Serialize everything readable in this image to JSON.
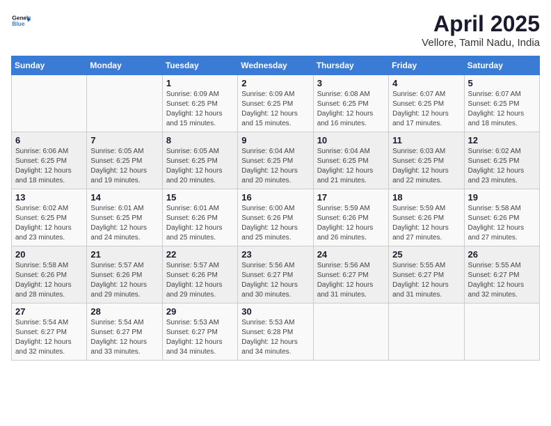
{
  "header": {
    "logo_line1": "General",
    "logo_line2": "Blue",
    "month": "April 2025",
    "location": "Vellore, Tamil Nadu, India"
  },
  "weekdays": [
    "Sunday",
    "Monday",
    "Tuesday",
    "Wednesday",
    "Thursday",
    "Friday",
    "Saturday"
  ],
  "weeks": [
    [
      {
        "day": "",
        "info": ""
      },
      {
        "day": "",
        "info": ""
      },
      {
        "day": "1",
        "info": "Sunrise: 6:09 AM\nSunset: 6:25 PM\nDaylight: 12 hours\nand 15 minutes."
      },
      {
        "day": "2",
        "info": "Sunrise: 6:09 AM\nSunset: 6:25 PM\nDaylight: 12 hours\nand 15 minutes."
      },
      {
        "day": "3",
        "info": "Sunrise: 6:08 AM\nSunset: 6:25 PM\nDaylight: 12 hours\nand 16 minutes."
      },
      {
        "day": "4",
        "info": "Sunrise: 6:07 AM\nSunset: 6:25 PM\nDaylight: 12 hours\nand 17 minutes."
      },
      {
        "day": "5",
        "info": "Sunrise: 6:07 AM\nSunset: 6:25 PM\nDaylight: 12 hours\nand 18 minutes."
      }
    ],
    [
      {
        "day": "6",
        "info": "Sunrise: 6:06 AM\nSunset: 6:25 PM\nDaylight: 12 hours\nand 18 minutes."
      },
      {
        "day": "7",
        "info": "Sunrise: 6:05 AM\nSunset: 6:25 PM\nDaylight: 12 hours\nand 19 minutes."
      },
      {
        "day": "8",
        "info": "Sunrise: 6:05 AM\nSunset: 6:25 PM\nDaylight: 12 hours\nand 20 minutes."
      },
      {
        "day": "9",
        "info": "Sunrise: 6:04 AM\nSunset: 6:25 PM\nDaylight: 12 hours\nand 20 minutes."
      },
      {
        "day": "10",
        "info": "Sunrise: 6:04 AM\nSunset: 6:25 PM\nDaylight: 12 hours\nand 21 minutes."
      },
      {
        "day": "11",
        "info": "Sunrise: 6:03 AM\nSunset: 6:25 PM\nDaylight: 12 hours\nand 22 minutes."
      },
      {
        "day": "12",
        "info": "Sunrise: 6:02 AM\nSunset: 6:25 PM\nDaylight: 12 hours\nand 23 minutes."
      }
    ],
    [
      {
        "day": "13",
        "info": "Sunrise: 6:02 AM\nSunset: 6:25 PM\nDaylight: 12 hours\nand 23 minutes."
      },
      {
        "day": "14",
        "info": "Sunrise: 6:01 AM\nSunset: 6:25 PM\nDaylight: 12 hours\nand 24 minutes."
      },
      {
        "day": "15",
        "info": "Sunrise: 6:01 AM\nSunset: 6:26 PM\nDaylight: 12 hours\nand 25 minutes."
      },
      {
        "day": "16",
        "info": "Sunrise: 6:00 AM\nSunset: 6:26 PM\nDaylight: 12 hours\nand 25 minutes."
      },
      {
        "day": "17",
        "info": "Sunrise: 5:59 AM\nSunset: 6:26 PM\nDaylight: 12 hours\nand 26 minutes."
      },
      {
        "day": "18",
        "info": "Sunrise: 5:59 AM\nSunset: 6:26 PM\nDaylight: 12 hours\nand 27 minutes."
      },
      {
        "day": "19",
        "info": "Sunrise: 5:58 AM\nSunset: 6:26 PM\nDaylight: 12 hours\nand 27 minutes."
      }
    ],
    [
      {
        "day": "20",
        "info": "Sunrise: 5:58 AM\nSunset: 6:26 PM\nDaylight: 12 hours\nand 28 minutes."
      },
      {
        "day": "21",
        "info": "Sunrise: 5:57 AM\nSunset: 6:26 PM\nDaylight: 12 hours\nand 29 minutes."
      },
      {
        "day": "22",
        "info": "Sunrise: 5:57 AM\nSunset: 6:26 PM\nDaylight: 12 hours\nand 29 minutes."
      },
      {
        "day": "23",
        "info": "Sunrise: 5:56 AM\nSunset: 6:27 PM\nDaylight: 12 hours\nand 30 minutes."
      },
      {
        "day": "24",
        "info": "Sunrise: 5:56 AM\nSunset: 6:27 PM\nDaylight: 12 hours\nand 31 minutes."
      },
      {
        "day": "25",
        "info": "Sunrise: 5:55 AM\nSunset: 6:27 PM\nDaylight: 12 hours\nand 31 minutes."
      },
      {
        "day": "26",
        "info": "Sunrise: 5:55 AM\nSunset: 6:27 PM\nDaylight: 12 hours\nand 32 minutes."
      }
    ],
    [
      {
        "day": "27",
        "info": "Sunrise: 5:54 AM\nSunset: 6:27 PM\nDaylight: 12 hours\nand 32 minutes."
      },
      {
        "day": "28",
        "info": "Sunrise: 5:54 AM\nSunset: 6:27 PM\nDaylight: 12 hours\nand 33 minutes."
      },
      {
        "day": "29",
        "info": "Sunrise: 5:53 AM\nSunset: 6:27 PM\nDaylight: 12 hours\nand 34 minutes."
      },
      {
        "day": "30",
        "info": "Sunrise: 5:53 AM\nSunset: 6:28 PM\nDaylight: 12 hours\nand 34 minutes."
      },
      {
        "day": "",
        "info": ""
      },
      {
        "day": "",
        "info": ""
      },
      {
        "day": "",
        "info": ""
      }
    ]
  ]
}
